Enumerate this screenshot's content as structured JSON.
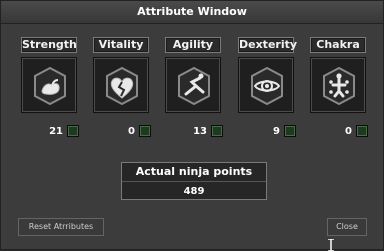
{
  "window": {
    "title": "Attribute Window"
  },
  "attributes": [
    {
      "label": "Strength",
      "value": "21",
      "icon": "arm-flex-icon"
    },
    {
      "label": "Vitality",
      "value": "0",
      "icon": "broken-heart-icon"
    },
    {
      "label": "Agility",
      "value": "13",
      "icon": "running-figure-icon"
    },
    {
      "label": "Dexterity",
      "value": "9",
      "icon": "eye-icon"
    },
    {
      "label": "Chakra",
      "value": "0",
      "icon": "chakra-figure-icon"
    }
  ],
  "points": {
    "label": "Actual ninja points",
    "value": "489"
  },
  "buttons": {
    "reset": "Reset Atrributes",
    "close": "Close"
  },
  "colors": {
    "window_bg": "#3c3c3c",
    "panel_bg": "#1f1f1f",
    "plus_button": "#1e3a1e"
  }
}
